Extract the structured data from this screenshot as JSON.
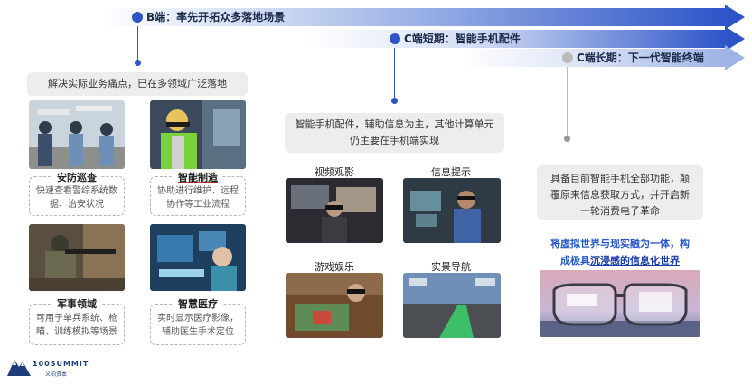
{
  "timeline": {
    "b_label": "B端：率先开拓众多落地场景",
    "c_short_label": "C端短期：智能手机配件",
    "c_long_label": "C端长期：下一代智能终端",
    "colors": {
      "arrow_dark": "#2d55c8",
      "arrow_light": "#dde6f7",
      "dot_b": "#2d55c8",
      "dot_c": "#bbbbbb"
    }
  },
  "b_section": {
    "callout": "解决实际业务痛点，已在多领域广泛落地",
    "cards": [
      {
        "title": "安防巡查",
        "desc": "快速查看警综系统数据、治安状况"
      },
      {
        "title": "智能制造",
        "desc": "协助进行维护、远程协作等工业流程"
      },
      {
        "title": "军事领域",
        "desc": "可用于单兵系统、枪瞄、训练模拟等场景"
      },
      {
        "title": "智慧医疗",
        "desc": "实时显示医疗影像，辅助医生手术定位"
      }
    ]
  },
  "c_short_section": {
    "callout": "智能手机配件，辅助信息为主，其他计算单元仍主要在手机端实现",
    "cards": [
      {
        "title": "视频观影"
      },
      {
        "title": "信息提示"
      },
      {
        "title": "游戏娱乐"
      },
      {
        "title": "实景导航"
      }
    ]
  },
  "c_long_section": {
    "callout": "具备目前智能手机全部功能，颠覆原来信息获取方式，并开启新一轮消费电子革命",
    "highlight_line1": "将虚拟世界与现实融为一体，构",
    "highlight_line2_prefix": "成极具",
    "highlight_line2_strong": "沉浸感的信息化世界"
  },
  "logo": {
    "brand": "100SUMMIT",
    "sub": "义柏资本"
  }
}
